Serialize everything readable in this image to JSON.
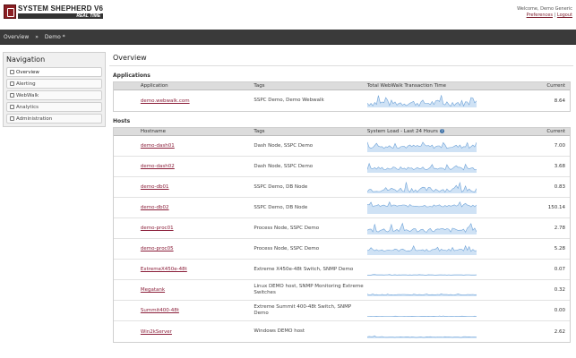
{
  "header": {
    "logo_title": "SYSTEM SHEPHERD V6",
    "logo_subtitle": "REAL TIME",
    "welcome_text": "Welcome, Demo Generic",
    "preferences_label": "Preferences",
    "separator": "|",
    "logout_label": "Logout"
  },
  "breadcrumb": {
    "items": [
      "Overview",
      "»",
      "Demo *"
    ]
  },
  "navigation": {
    "title": "Navigation",
    "items": [
      {
        "label": "Overview",
        "icon": "home-icon",
        "active": true
      },
      {
        "label": "Alerting",
        "icon": "alert-icon",
        "active": false
      },
      {
        "label": "WebWalk",
        "icon": "walk-icon",
        "active": false
      },
      {
        "label": "Analytics",
        "icon": "chart-icon",
        "active": false
      },
      {
        "label": "Administration",
        "icon": "edit-icon",
        "active": false
      }
    ]
  },
  "main": {
    "title": "Overview",
    "applications": {
      "section_title": "Applications",
      "columns": [
        "Application",
        "Tags",
        "Total WebWalk Transaction Time",
        "Current"
      ],
      "rows": [
        {
          "name": "demo.webwalk.com",
          "tags": "SSPC Demo, Demo Webwalk",
          "current": "8.64"
        }
      ]
    },
    "hosts": {
      "section_title": "Hosts",
      "columns": [
        "Hostname",
        "Tags",
        "System Load - Last 24 Hours",
        "Current"
      ],
      "help_icon": "?",
      "rows": [
        {
          "name": "demo-dash01",
          "tags": "Dash Node, SSPC Demo",
          "current": "7.00"
        },
        {
          "name": "demo-dash02",
          "tags": "Dash Node, SSPC Demo",
          "current": "3.68"
        },
        {
          "name": "demo-db01",
          "tags": "SSPC Demo, DB Node",
          "current": "0.83"
        },
        {
          "name": "demo-db02",
          "tags": "SSPC Demo, DB Node",
          "current": "150.14"
        },
        {
          "name": "demo-proc01",
          "tags": "Process Node, SSPC Demo",
          "current": "2.78"
        },
        {
          "name": "demo-proc05",
          "tags": "Process Node, SSPC Demo",
          "current": "5.28"
        },
        {
          "name": "ExtremeX450e-48t",
          "tags": "Extreme X450e-48t Switch, SNMP Demo",
          "current": "0.07"
        },
        {
          "name": "Megatank",
          "tags": "Linux DEMO host, SNMP Monitoring Extreme Switches",
          "current": "0.32"
        },
        {
          "name": "Summit400-48t",
          "tags": "Extreme Summit 400-48t Switch, SNMP Demo",
          "current": "0.00"
        },
        {
          "name": "Win2kServer",
          "tags": "Windows DEMO host",
          "current": "2.62"
        }
      ]
    }
  },
  "colors": {
    "accent": "#8b1f3a",
    "spark_line": "#6fa3d8",
    "spark_fill": "#cfe2f5",
    "header_bar": "#3a3a3a"
  }
}
